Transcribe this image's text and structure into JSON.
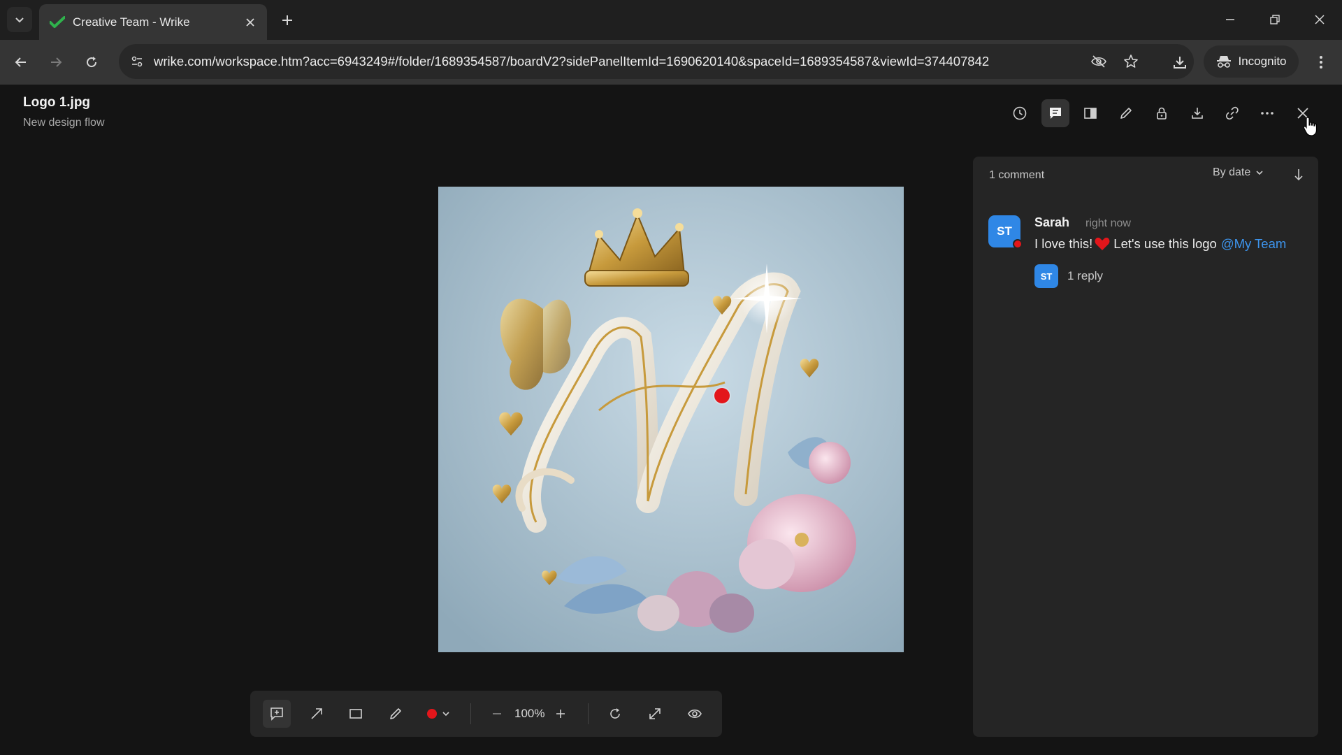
{
  "browser": {
    "tab_title": "Creative Team - Wrike",
    "url": "wrike.com/workspace.htm?acc=6943249#/folder/1689354587/boardV2?sidePanelItemId=1690620140&spaceId=1689354587&viewId=374407842",
    "incognito_label": "Incognito"
  },
  "file": {
    "name": "Logo 1.jpg",
    "subtitle": "New design flow"
  },
  "header_icons": [
    "history-icon",
    "comments-icon",
    "compare-icon",
    "edit-icon",
    "lock-icon",
    "download-icon",
    "link-icon",
    "more-icon",
    "close-icon"
  ],
  "viewer": {
    "zoom": "100%",
    "image_alt": "Ornate letter M logo with gold crown, butterfly and pink flowers",
    "annotation_color": "#e3161b"
  },
  "comments_panel": {
    "count_label": "1 comment",
    "sort_label": "By date",
    "comments": [
      {
        "initials": "ST",
        "author": "Sarah",
        "time": "right now",
        "text_before": "I love this!",
        "text_after": "Let's use this logo",
        "mention": "@My Team",
        "reply_initials": "ST",
        "replies_label": "1 reply"
      }
    ]
  },
  "colors": {
    "accent_blue": "#2f87e6",
    "mention_blue": "#3d95ee",
    "pin_red": "#e3161b",
    "wrike_green": "#2fb24c"
  }
}
